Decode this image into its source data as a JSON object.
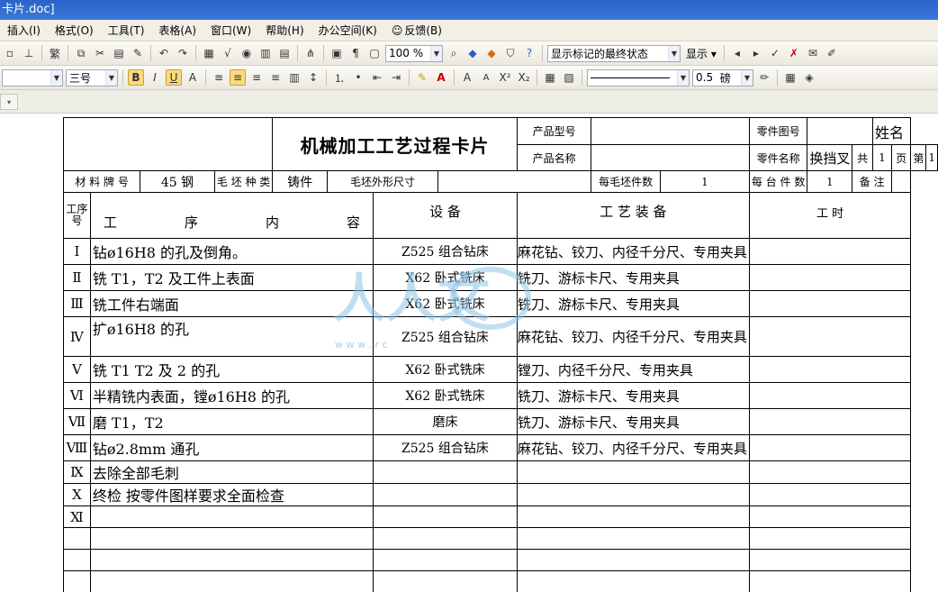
{
  "window": {
    "title": "卡片.doc]"
  },
  "menu": [
    "插入(I)",
    "格式(O)",
    "工具(T)",
    "表格(A)",
    "窗口(W)",
    "帮助(H)",
    "办公空间(K)",
    "反馈(B)"
  ],
  "toolbar1": {
    "zoom": "100 %",
    "markup_state": "显示标记的最终状态",
    "show_label": "显示"
  },
  "toolbar2": {
    "font_size": "三号",
    "line_weight": "0.5",
    "line_unit": "磅"
  },
  "card": {
    "title": "机械加工工艺过程卡片",
    "product_model_label": "产品型号",
    "product_name_label": "产品名称",
    "part_drawing_label": "零件图号",
    "part_name_label": "零件名称",
    "part_name": "换挡叉",
    "name_label": "姓名",
    "total_label": "共",
    "total_pages": "1",
    "page_label": "页",
    "page_no_label": "第",
    "page_no": "1",
    "material_label": "材 料 牌 号",
    "material": "45 钢",
    "blank_type_label": "毛 坯 种 类",
    "blank_type": "铸件",
    "blank_size_label": "毛坯外形尺寸",
    "blanks_per_label": "每毛坯件数",
    "blanks_per": "1",
    "per_unit_label": "每 台 件 数",
    "per_unit": "1",
    "notes_label": "备 注",
    "col_seq": "工序号",
    "col_content": [
      "工",
      "序",
      "内",
      "容"
    ],
    "col_equipment": "设    备",
    "col_tooling": "工    艺    装    备",
    "col_hours": "工        时"
  },
  "operations": [
    {
      "no": "Ⅰ",
      "content": "钻ø16H8 的孔及倒角。",
      "equipment": "Z525 组合钻床",
      "tooling": "麻花钻、铰刀、内径千分尺、专用夹具"
    },
    {
      "no": "Ⅱ",
      "content": "铣 T1，T2 及工件上表面",
      "equipment": "X62 卧式铣床",
      "tooling": "铣刀、游标卡尺、专用夹具"
    },
    {
      "no": "Ⅲ",
      "content": "铣工件右端面",
      "equipment": "X62 卧式铣床",
      "tooling": "铣刀、游标卡尺、专用夹具"
    },
    {
      "no": "Ⅳ",
      "content": "扩ø16H8 的孔",
      "equipment": "Z525 组合钻床",
      "tooling": "麻花钻、铰刀、内径千分尺、专用夹具"
    },
    {
      "no": "Ⅴ",
      "content": "铣 T1   T2 及  2 的孔",
      "equipment": "X62 卧式铣床",
      "tooling": "镗刀、内径千分尺、专用夹具"
    },
    {
      "no": "Ⅵ",
      "content": "半精铣内表面，镗ø16H8 的孔",
      "equipment": "X62 卧式铣床",
      "tooling": "铣刀、游标卡尺、专用夹具"
    },
    {
      "no": "Ⅶ",
      "content": "磨 T1，T2",
      "equipment": "磨床",
      "tooling": "铣刀、游标卡尺、专用夹具"
    },
    {
      "no": "Ⅷ",
      "content": "钻ø2.8mm 通孔",
      "equipment": "Z525 组合钻床",
      "tooling": "麻花钻、铰刀、内径千分尺、专用夹具"
    },
    {
      "no": "Ⅸ",
      "content": "去除全部毛刺",
      "equipment": "",
      "tooling": ""
    },
    {
      "no": "Ⅹ",
      "content": "终检 按零件图样要求全面检查",
      "equipment": "",
      "tooling": ""
    },
    {
      "no": "Ⅺ",
      "content": "",
      "equipment": "",
      "tooling": ""
    },
    {
      "no": "",
      "content": "",
      "equipment": "",
      "tooling": ""
    },
    {
      "no": "",
      "content": "",
      "equipment": "",
      "tooling": ""
    },
    {
      "no": "",
      "content": "",
      "equipment": "",
      "tooling": ""
    }
  ],
  "watermark": {
    "url": "w w w . r                  c"
  }
}
